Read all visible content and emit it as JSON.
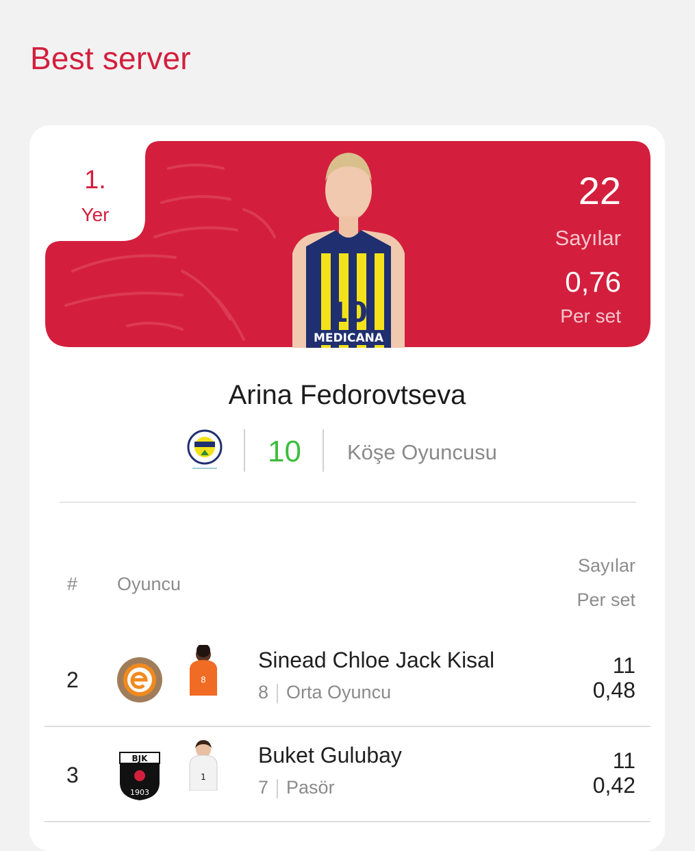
{
  "page": {
    "title": "Best server"
  },
  "hero": {
    "rank": "1.",
    "rank_label": "Yer",
    "points": "22",
    "points_label": "Sayılar",
    "per_set": "0,76",
    "per_set_label": "Per set",
    "bg_color": "#d31f3d"
  },
  "leader": {
    "name": "Arina Fedorovtseva",
    "team_logo": "fenerbahce-logo",
    "jersey": "10",
    "position": "Köşe Oyuncusu"
  },
  "table": {
    "col_rank": "#",
    "col_player": "Oyuncu",
    "col_points": "Sayılar",
    "col_per_set": "Per set",
    "rows": [
      {
        "rank": "2",
        "team_logo": "eczacibasi-logo",
        "name": "Sinead Chloe Jack Kisal",
        "jersey": "8",
        "position": "Orta Oyuncu",
        "points": "11",
        "per_set": "0,48"
      },
      {
        "rank": "3",
        "team_logo": "besiktas-logo",
        "name": "Buket Gulubay",
        "jersey": "7",
        "position": "Pasör",
        "points": "11",
        "per_set": "0,42"
      }
    ]
  }
}
